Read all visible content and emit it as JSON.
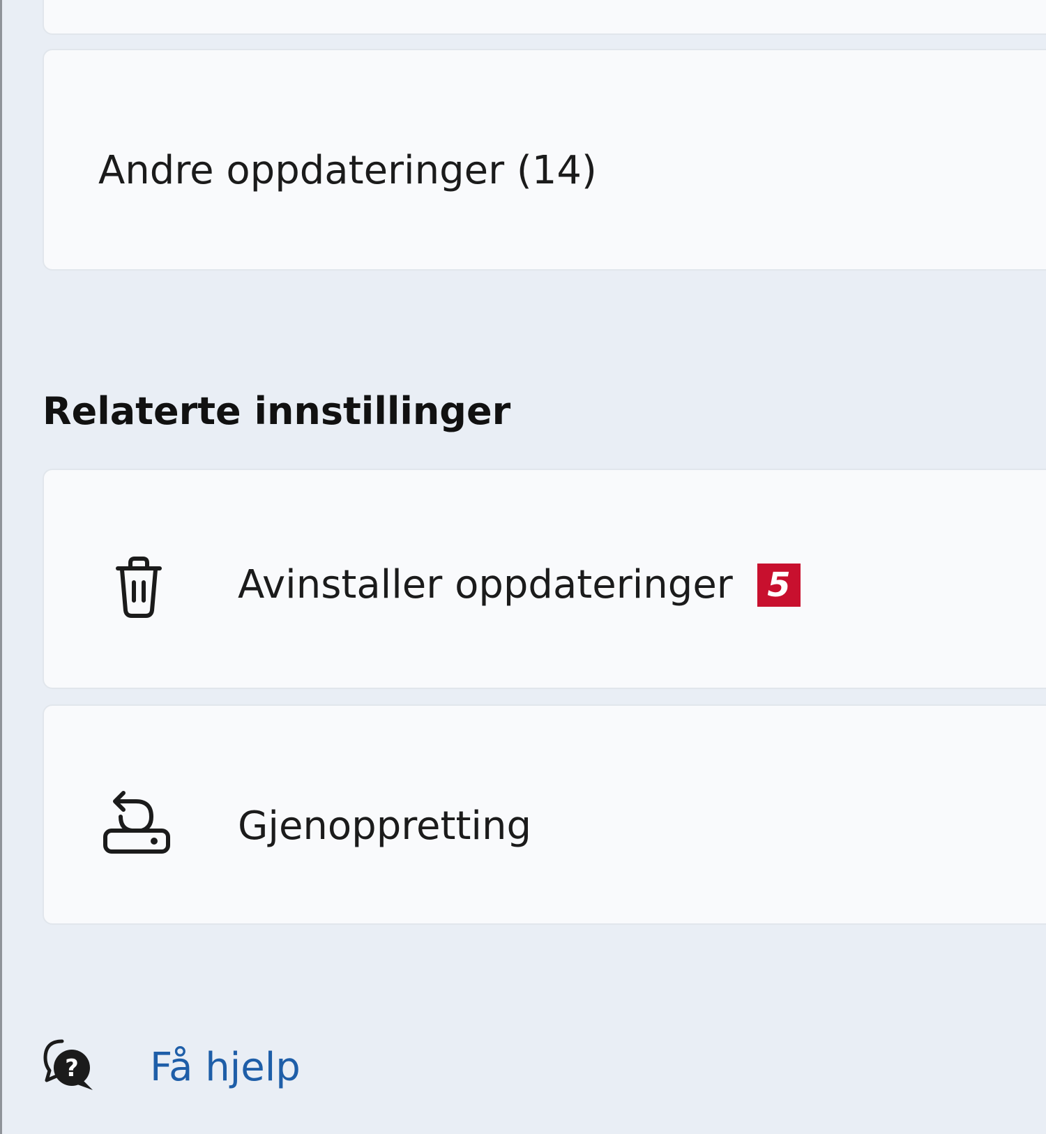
{
  "updates": {
    "other_updates_label": "Andre oppdateringer (14)"
  },
  "related": {
    "title": "Relaterte innstillinger",
    "uninstall": {
      "label": "Avinstaller oppdateringer",
      "badge": "5",
      "icon": "trash-icon"
    },
    "recovery": {
      "label": "Gjenoppretting",
      "icon": "recovery-icon"
    }
  },
  "help": {
    "label": "Få hjelp",
    "icon": "help-chat-icon"
  },
  "colors": {
    "page_background": "#e9eef5",
    "card_background": "#f9fafc",
    "link": "#1e5ea8",
    "badge": "#c8102e"
  }
}
